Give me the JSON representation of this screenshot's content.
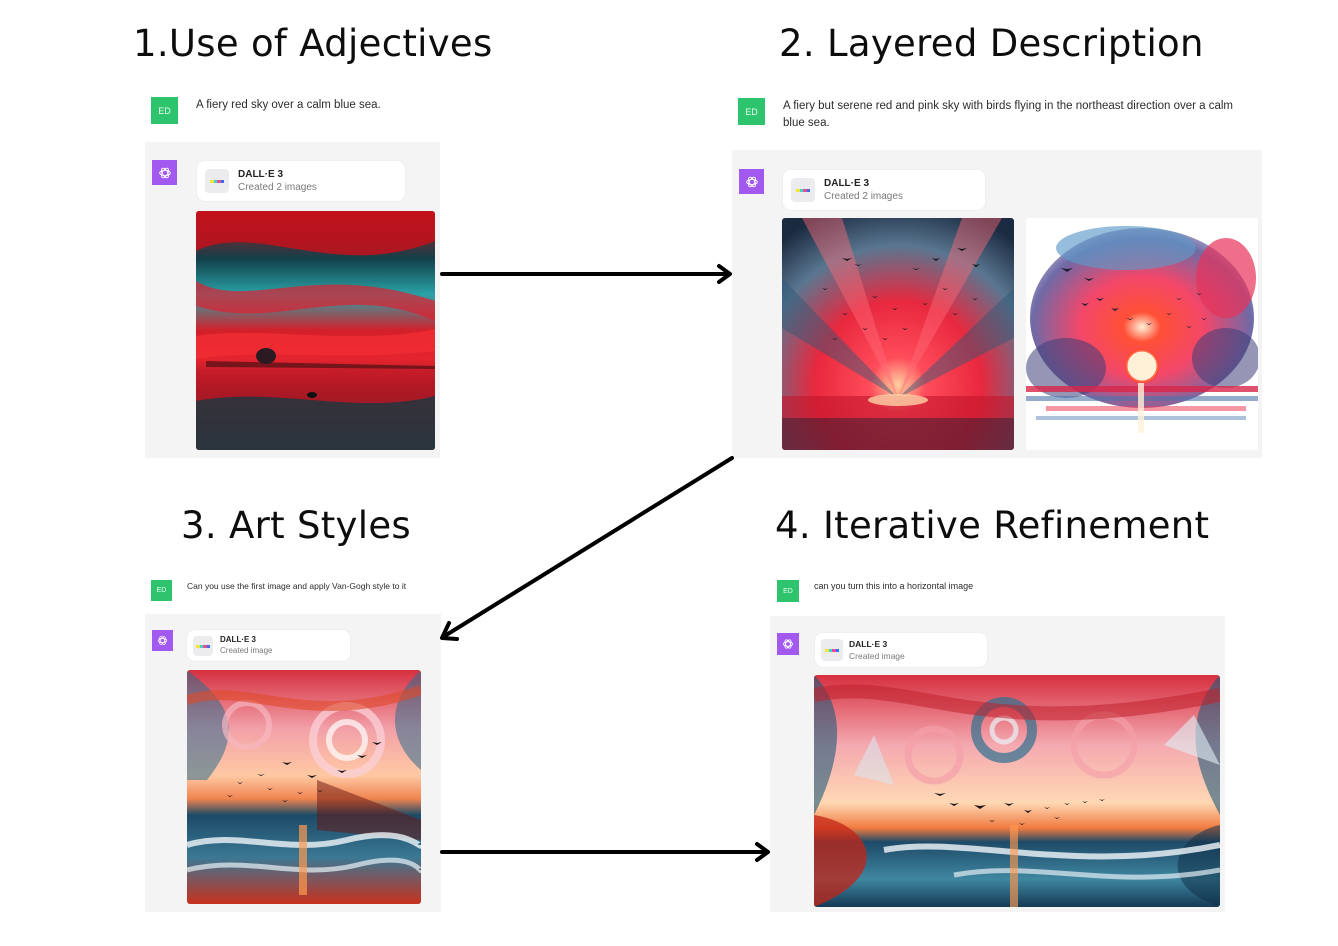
{
  "steps": [
    {
      "title": "1.Use of Adjectives",
      "user_avatar": "ED",
      "prompt": "A fiery red sky over a calm blue sea.",
      "tool_name": "DALL·E 3",
      "tool_status": "Created 2 images",
      "images": [
        {
          "description": "Photorealistic fiery red sky with teal clouds over a dark calm sea with a small boat silhouette"
        }
      ]
    },
    {
      "title": "2. Layered Description",
      "user_avatar": "ED",
      "prompt": "A fiery but serene red and pink sky with birds flying in the northeast direction over a calm blue sea.",
      "tool_name": "DALL·E 3",
      "tool_status": "Created 2 images",
      "images": [
        {
          "description": "Photorealistic red and pink sunset with rays and a flock of birds over a calm sea"
        },
        {
          "description": "Watercolor red and pink sky with birds and a setting sun over blue water"
        }
      ]
    },
    {
      "title": "3. Art Styles",
      "user_avatar": "ED",
      "prompt": "Can you use the first image and apply Van-Gogh style to it",
      "tool_name": "DALL·E 3",
      "tool_status": "Created image",
      "images": [
        {
          "description": "Van Gogh style swirling red, pink and teal sky with birds over a wavy sea (portrait)"
        }
      ]
    },
    {
      "title": "4. Iterative Refinement",
      "user_avatar": "ED",
      "prompt": "can you turn this into a horizontal image",
      "tool_name": "DALL·E 3",
      "tool_status": "Created image",
      "images": [
        {
          "description": "Van Gogh style swirling sky with birds over crashing waves (landscape)"
        }
      ]
    }
  ],
  "arrows": [
    {
      "from": "step-1",
      "to": "step-2"
    },
    {
      "from": "step-2",
      "to": "step-3"
    },
    {
      "from": "step-3",
      "to": "step-4"
    }
  ],
  "colors": {
    "user_avatar": "#2ec46d",
    "assistant_avatar": "#a259f0",
    "assistant_row_bg": "#f4f4f5",
    "arrow": "#000000"
  }
}
